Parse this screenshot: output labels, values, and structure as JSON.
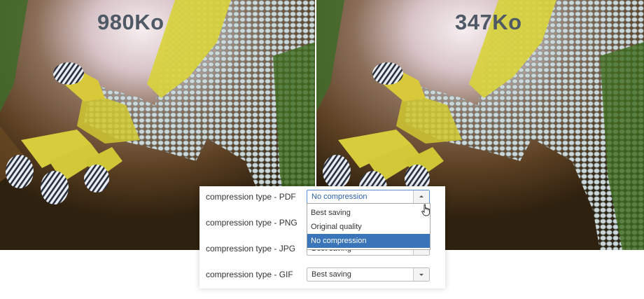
{
  "comparison": {
    "original_size": "980Ko",
    "compressed_size": "347Ko"
  },
  "settings": {
    "rows": [
      {
        "label": "compression type - PDF",
        "value": "No compression",
        "open": true
      },
      {
        "label": "compression type - PNG",
        "value": ""
      },
      {
        "label": "compression type - JPG",
        "value": "Best saving"
      },
      {
        "label": "compression type - GIF",
        "value": "Best saving"
      }
    ],
    "dropdown_options": [
      "Best saving",
      "Original quality",
      "No compression"
    ],
    "selected_option": "No compression"
  },
  "colors": {
    "selected_bg": "#3a75ba",
    "size_label": "#4f5a66"
  },
  "icons": [
    "hand-pointer-icon",
    "dropdown-caret-icon"
  ]
}
